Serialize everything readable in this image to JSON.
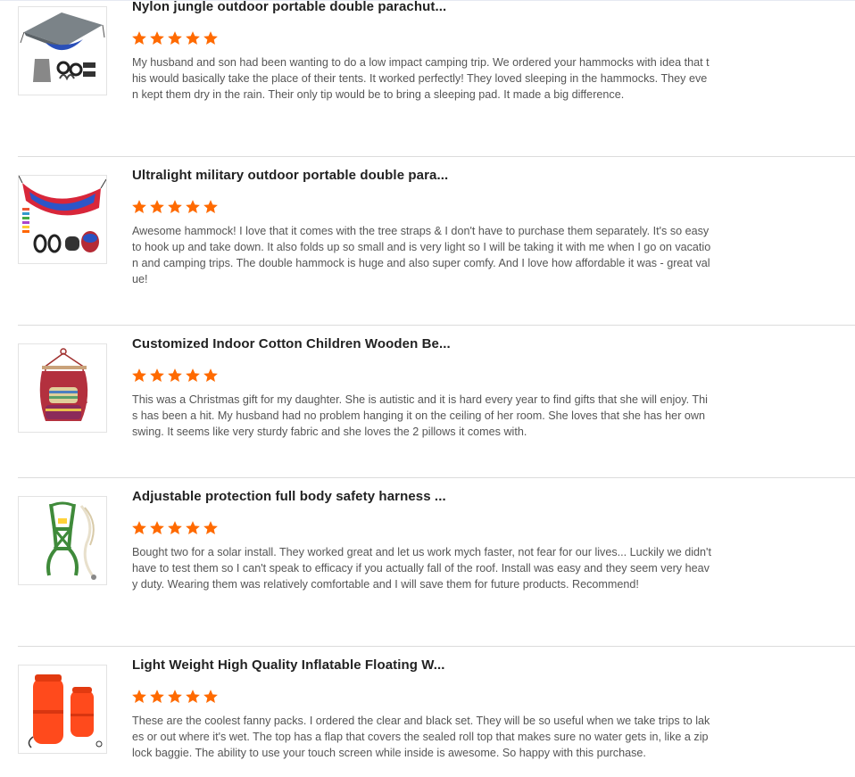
{
  "colors": {
    "star": "#ff6a00",
    "title": "#222222",
    "text": "#555555",
    "divider": "#dcdcdc"
  },
  "reviews": [
    {
      "title": "Nylon jungle outdoor portable double parachut...",
      "rating": 5,
      "image_icon": "hammock-tarp-set-icon",
      "text": "My husband and son had been wanting to do a low impact camping trip. We ordered your hammocks with idea that this would basically take the place of their tents. It worked perfectly! They loved sleeping in the hammocks. They even kept them dry in the rain. Their only tip would be to bring a sleeping pad. It made a big difference."
    },
    {
      "title": "Ultralight military outdoor portable double para...",
      "rating": 5,
      "image_icon": "parachute-hammock-icon",
      "text": "Awesome hammock! I love that it comes with the tree straps & I don't have to purchase them separately. It's so easy to hook up and take down. It also folds up so small and is very light so I will be taking it with me when I go on vacation and camping trips. The double hammock is huge and also super comfy. And I love how affordable it was - great value!"
    },
    {
      "title": "Customized Indoor Cotton Children Wooden Be...",
      "rating": 5,
      "image_icon": "hanging-chair-swing-icon",
      "text": "This was a Christmas gift for my daughter. She is autistic and it is hard every year to find gifts that she will enjoy. This has been a hit. My husband had no problem hanging it on the ceiling of her room. She loves that she has her own swing. It seems like very sturdy fabric and she loves the 2 pillows it comes with."
    },
    {
      "title": "Adjustable protection full body safety harness ...",
      "rating": 5,
      "image_icon": "safety-harness-icon",
      "text": "Bought two for a solar install. They worked great and let us work mych faster, not fear for our lives... Luckily we didn't have to test them so I can't speak to efficacy if you actually fall of the roof. Install was easy and they seem very heavy duty. Wearing them was relatively comfortable and I will save them for future products. Recommend!"
    },
    {
      "title": "Light Weight High Quality Inflatable Floating W...",
      "rating": 5,
      "image_icon": "dry-bag-float-icon",
      "text": "These are the coolest fanny packs. I ordered the clear and black set. They will be so useful when we take trips to lakes or out where it's wet. The top has a flap that covers the sealed roll top that makes sure no water gets in, like a zip lock baggie. The ability to use your touch screen while inside is awesome. So happy with this purchase."
    }
  ]
}
